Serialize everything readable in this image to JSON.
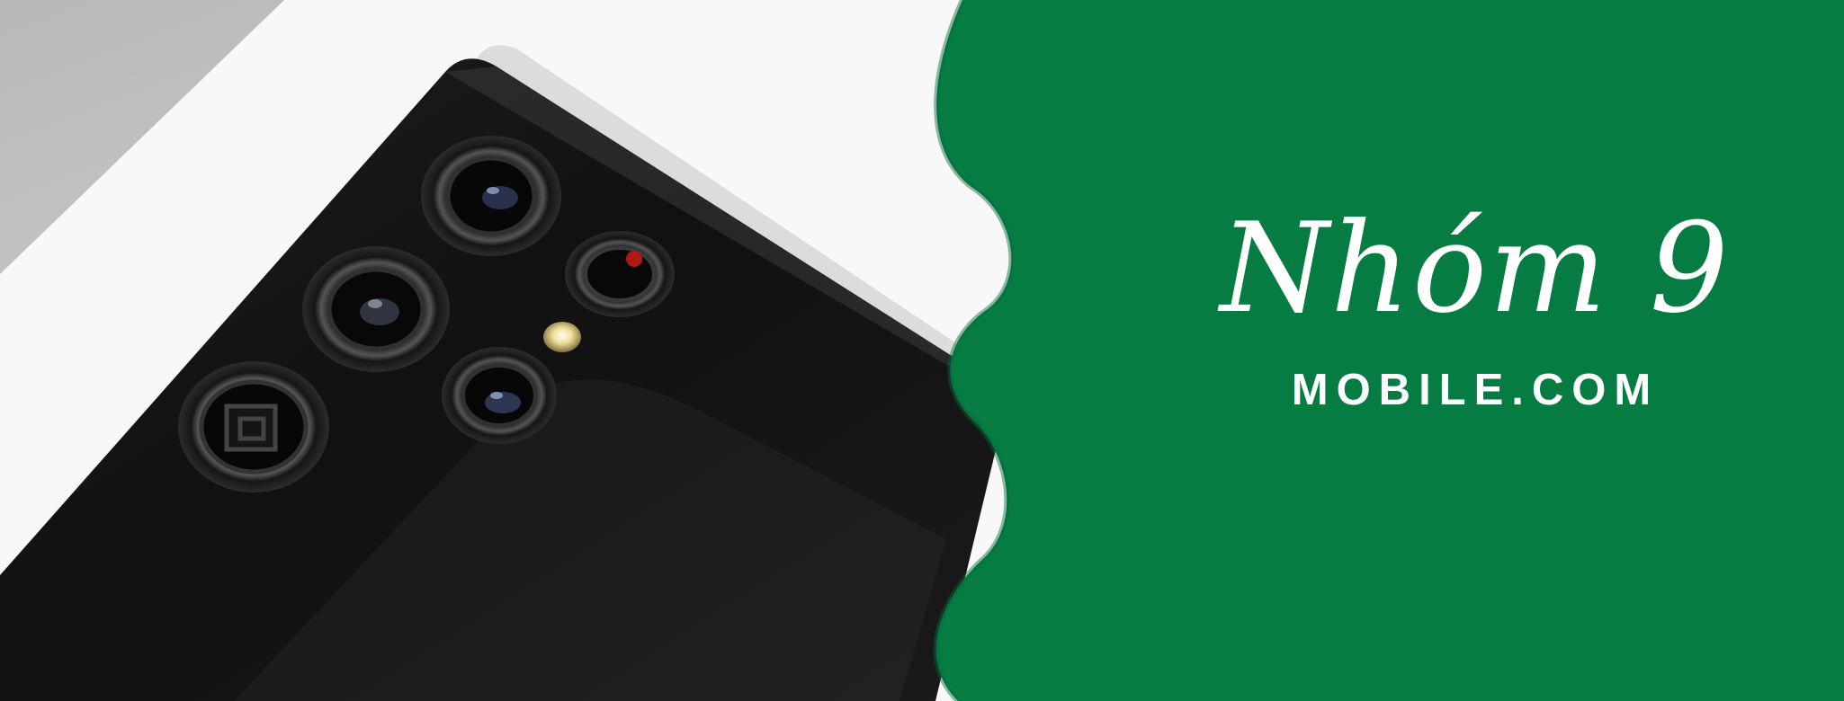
{
  "brand": {
    "name": "Nhóm 9",
    "domain": "MOBILE.COM"
  },
  "colors": {
    "panel": "#067C43",
    "background": "#D8D8D8",
    "phone": "#161616",
    "box": "#F8F8F8"
  },
  "icons": {
    "main_visual": "smartphone-camera-module-photo"
  }
}
